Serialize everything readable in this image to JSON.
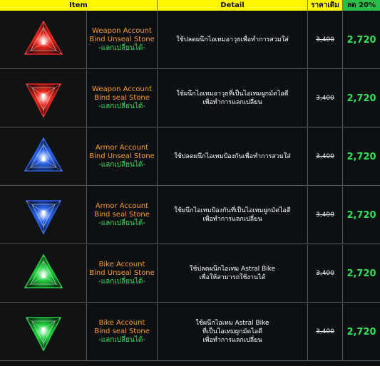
{
  "header": {
    "item": "Item",
    "detail": "Detail",
    "old_price": "ราคาเดิม",
    "discount": "ลด 20%"
  },
  "rows": [
    {
      "gem_icon": "red-triangle-gem-icon",
      "gem_color": "#e8281e",
      "name_line1": "Weapon Account",
      "name_line2": "Bind Unseal Stone",
      "tradeable": "-แลกเปลี่ยนได้-",
      "detail_lines": [
        "ใช้ปลดผนึกไอเทมอาวุธเพื่อทำการสวมใส่"
      ],
      "old_price": "3,400",
      "new_price": "2,720"
    },
    {
      "gem_icon": "red-inverted-triangle-gem-icon",
      "gem_color": "#e8281e",
      "name_line1": "Weapon Account",
      "name_line2": "Bind seal Stone",
      "tradeable": "-แลกเปลี่ยนได้-",
      "detail_lines": [
        "ใช้ผนึกไอเทมอาวุธที่เป็นไอเทมผูกมัดไอดี",
        "เพื่อทำการแลกเปลี่ยน"
      ],
      "old_price": "3,400",
      "new_price": "2,720"
    },
    {
      "gem_icon": "blue-triangle-gem-icon",
      "gem_color": "#2a63e8",
      "name_line1": "Armor Account",
      "name_line2": "Bind Unseal Stone",
      "tradeable": "-แลกเปลี่ยนได้-",
      "detail_lines": [
        "ใช้ปลดผนึกไอเทมป้องกันเพื่อทำการสวมใส่"
      ],
      "old_price": "3,400",
      "new_price": "2,720"
    },
    {
      "gem_icon": "blue-inverted-triangle-gem-icon",
      "gem_color": "#2a63e8",
      "name_line1": "Armor Account",
      "name_line2": "Bind seal Stone",
      "tradeable": "-แลกเปลี่ยนได้-",
      "detail_lines": [
        "ใช้ผนึกไอเทมป้องกันที่เป็นไอเทมผูกมัดไอดี",
        "เพื่อทำการแลกเปลี่ยน"
      ],
      "old_price": "3,400",
      "new_price": "2,720"
    },
    {
      "gem_icon": "green-triangle-gem-icon",
      "gem_color": "#22d040",
      "name_line1": "Bike Account",
      "name_line2": "Bind Unseal Stone",
      "tradeable": "-แลกเปลี่ยนได้-",
      "detail_lines": [
        "ใช้ปลดผนึกไอเทม Astral Bike",
        "เพื่อให้สามารถใช้งานได้"
      ],
      "old_price": "3,400",
      "new_price": "2,720"
    },
    {
      "gem_icon": "green-inverted-triangle-gem-icon",
      "gem_color": "#22d040",
      "name_line1": "Bike Account",
      "name_line2": "Bind seal Stone",
      "tradeable": "-แลกเปลี่ยนได้-",
      "detail_lines": [
        "ใช้ผนึกไอเทม Astral Bike",
        "ที่เป็นไอเทมผูกมัดไอดี",
        "เพื่อทำการแลกเปลี่ยน"
      ],
      "old_price": "3,400",
      "new_price": "2,720"
    }
  ]
}
